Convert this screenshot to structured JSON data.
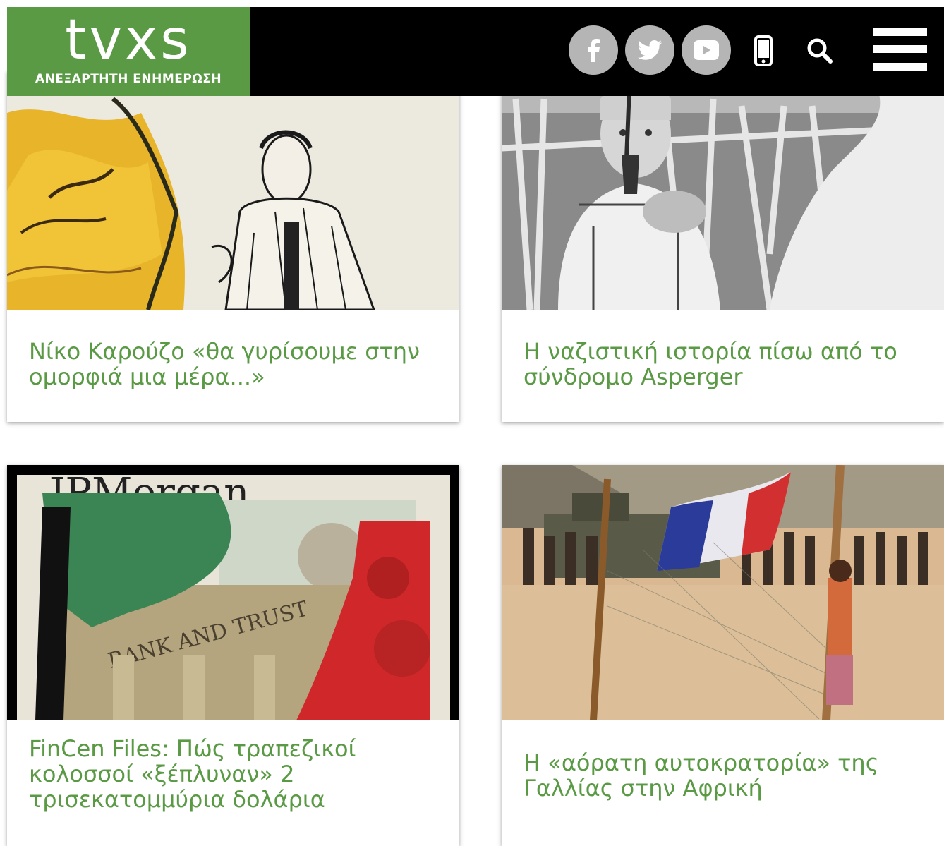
{
  "header": {
    "logo_word": "tvxs",
    "logo_tagline": "ΑΝΕΞΑΡΤΗΤΗ ΕΝΗΜΕΡΩΣΗ",
    "brand_color": "#5a9a45",
    "social_icons": [
      "facebook-icon",
      "twitter-icon",
      "youtube-icon"
    ],
    "tool_icons": [
      "mobile-icon",
      "search-icon",
      "menu-icon"
    ]
  },
  "articles": [
    {
      "title": "Νίκο Καρούζο «θα γυρίσουμε στην ομορφιά μια μέρα...»"
    },
    {
      "title": "Η ναζιστική ιστορία πίσω από το σύνδρομο Asperger"
    },
    {
      "title": "FinCen Files: Πώς τραπεζικοί κολοσσοί «ξέπλυναν» 2 τρισεκατομμύρια δολάρια",
      "image_text": "BANK AND TRUST"
    },
    {
      "title": "Η «αόρατη αυτοκρατορία» της Γαλλίας στην Αφρική"
    }
  ]
}
